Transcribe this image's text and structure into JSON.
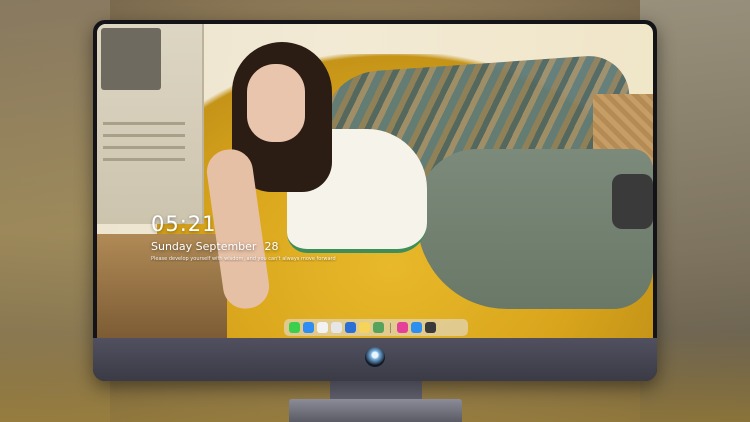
{
  "lock_screen": {
    "time": "05:21",
    "date_text": "Sunday September",
    "day_number": "28",
    "quote": "Please develop yourself with wisdom, and you can't always move forward"
  },
  "dock": {
    "apps": [
      {
        "name": "messages-icon",
        "color": "#3ccf4e"
      },
      {
        "name": "finder-icon",
        "color": "#2f8df3"
      },
      {
        "name": "safari-icon",
        "color": "#f2f2f2"
      },
      {
        "name": "photos-icon",
        "color": "#e6e6e6"
      },
      {
        "name": "clapper-icon",
        "color": "#2a6fd6"
      },
      {
        "name": "notes-icon",
        "color": "#f6d35b"
      },
      {
        "name": "image-viewer-icon",
        "color": "#58a35b"
      },
      {
        "name": "music-icon",
        "color": "#e4409a"
      },
      {
        "name": "app-store-icon",
        "color": "#2d8ff0"
      },
      {
        "name": "system-icon",
        "color": "#3a3a3a"
      }
    ]
  },
  "colors": {
    "frame": "#141418",
    "chin": "#47474f",
    "wallpaper_sofa": "#e2b01f"
  }
}
